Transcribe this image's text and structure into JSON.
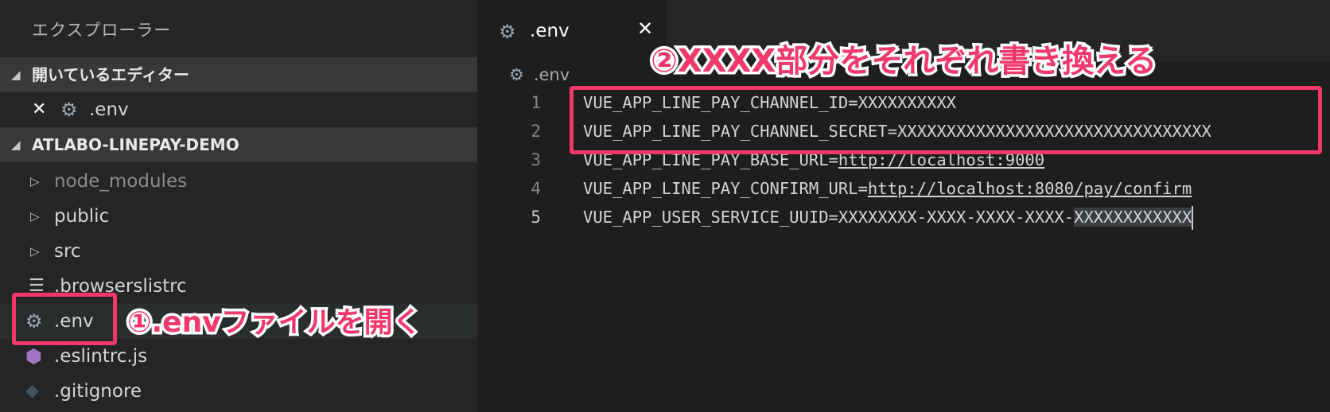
{
  "sidebar": {
    "title": "エクスプローラー",
    "open_editors": {
      "header": "開いているエディター",
      "items": [
        {
          "close": "✕",
          "name": ".env"
        }
      ]
    },
    "project": {
      "header": "ATLABO-LINEPAY-DEMO",
      "items": [
        {
          "name": "node_modules",
          "kind": "folder"
        },
        {
          "name": "public",
          "kind": "folder"
        },
        {
          "name": "src",
          "kind": "folder"
        },
        {
          "name": ".browserslistrc",
          "kind": "file"
        },
        {
          "name": ".env",
          "kind": "file"
        },
        {
          "name": ".eslintrc.js",
          "kind": "file"
        },
        {
          "name": ".gitignore",
          "kind": "file"
        }
      ]
    }
  },
  "editor": {
    "tab": {
      "name": ".env",
      "close": "✕"
    },
    "breadcrumb": ".env",
    "lines": [
      {
        "num": "1",
        "text": "VUE_APP_LINE_PAY_CHANNEL_ID=XXXXXXXXXX"
      },
      {
        "num": "2",
        "text": "VUE_APP_LINE_PAY_CHANNEL_SECRET=XXXXXXXXXXXXXXXXXXXXXXXXXXXXXXXX"
      },
      {
        "num": "3",
        "prefix": "VUE_APP_LINE_PAY_BASE_URL=",
        "url": "http://localhost:9000"
      },
      {
        "num": "4",
        "prefix": "VUE_APP_LINE_PAY_CONFIRM_URL=",
        "url": "http://localhost:8080/pay/confirm"
      },
      {
        "num": "5",
        "prefix": "VUE_APP_USER_SERVICE_UUID=XXXXXXXX-XXXX-XXXX-XXXX-",
        "selected": "XXXXXXXXXXXX"
      }
    ]
  },
  "annotations": {
    "step1": "①.envファイルを開く",
    "step2": "②XXXX部分をそれぞれ書き換える",
    "color": "#f0386b"
  },
  "colors": {
    "sidebar_bg": "#252526",
    "editor_bg": "#1e1e1e",
    "section_header_bg": "#383838"
  }
}
